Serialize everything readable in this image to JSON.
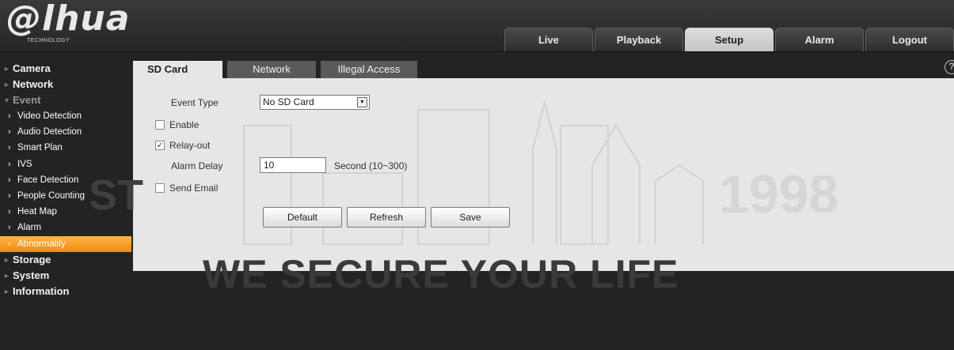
{
  "brand": {
    "logo": "@lhua",
    "tagline": "TECHNOLOGY"
  },
  "nav": {
    "tabs": [
      "Live",
      "Playback",
      "Setup",
      "Alarm",
      "Logout"
    ],
    "active": "Setup"
  },
  "sidebar": {
    "sections": [
      "Camera",
      "Network",
      "Event",
      "Storage",
      "System",
      "Information"
    ],
    "event_items": [
      "Video Detection",
      "Audio Detection",
      "Smart Plan",
      "IVS",
      "Face Detection",
      "People Counting",
      "Heat Map",
      "Alarm",
      "Abnormality"
    ],
    "active_item": "Abnormality"
  },
  "subtabs": [
    "SD Card",
    "Network",
    "Illegal Access"
  ],
  "help_glyph": "?",
  "form": {
    "event_type_label": "Event Type",
    "event_type_value": "No SD Card",
    "enable_label": "Enable",
    "enable_checked": false,
    "relay_label": "Relay-out",
    "relay_checked": true,
    "alarm_delay_label": "Alarm Delay",
    "alarm_delay_value": "10",
    "alarm_delay_unit": "Second (10~300)",
    "send_email_label": "Send Email",
    "send_email_checked": false
  },
  "buttons": {
    "default": "Default",
    "refresh": "Refresh",
    "save": "Save"
  },
  "watermark": {
    "year": "1998",
    "slogan": "WE SECURE YOUR LIFE",
    "left_fragment": "ST"
  },
  "colors": {
    "accent": "#f39a1e",
    "panel": "#e6e6e6",
    "background": "#232323"
  }
}
